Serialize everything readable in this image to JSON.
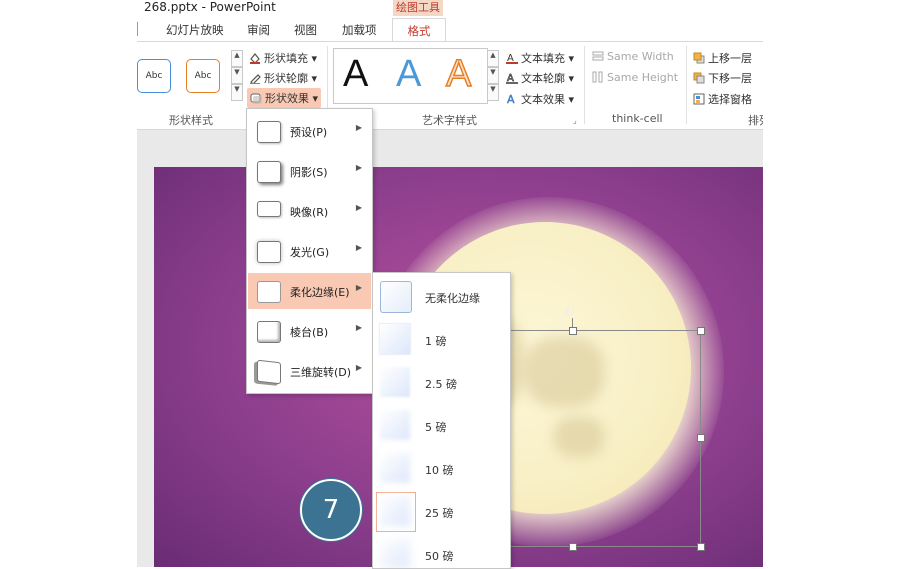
{
  "window": {
    "title": "268.pptx - PowerPoint"
  },
  "ribbon": {
    "context_tab": "绘图工具",
    "tabs": [
      "幻灯片放映",
      "审阅",
      "视图",
      "加载项"
    ],
    "active_tab": "格式",
    "shape_styles": {
      "sample_label": "Abc",
      "fill": "形状填充",
      "outline": "形状轮廓",
      "effects": "形状效果",
      "group_label": "形状样式"
    },
    "wordart": {
      "glyph": "A",
      "text_fill": "文本填充",
      "text_outline": "文本轮廓",
      "text_effects": "文本效果",
      "group_label": "艺术字样式"
    },
    "think_cell": {
      "same_width": "Same Width",
      "same_height": "Same Height",
      "group_label": "think-cell"
    },
    "arrange": {
      "bring_forward": "上移一层",
      "send_backward": "下移一层",
      "selection_pane": "选择窗格",
      "group_label": "排列"
    }
  },
  "effects_menu": {
    "items": [
      {
        "label": "预设(P)"
      },
      {
        "label": "阴影(S)"
      },
      {
        "label": "映像(R)"
      },
      {
        "label": "发光(G)"
      },
      {
        "label": "柔化边缘(E)",
        "highlighted": true
      },
      {
        "label": "棱台(B)"
      },
      {
        "label": "三维旋转(D)"
      }
    ]
  },
  "soft_edges_submenu": {
    "items": [
      {
        "label": "无柔化边缘"
      },
      {
        "label": "1 磅"
      },
      {
        "label": "2.5 磅"
      },
      {
        "label": "5 磅"
      },
      {
        "label": "10 磅"
      },
      {
        "label": "25 磅",
        "selected": true
      },
      {
        "label": "50 磅"
      }
    ]
  },
  "step_badge": "7",
  "colors": {
    "accent": "#c0392b",
    "menu_highlight": "#f9c9b4",
    "slide_bg": "#8d3f8e",
    "moon": "#f8efc5",
    "badge": "#3c7392"
  }
}
